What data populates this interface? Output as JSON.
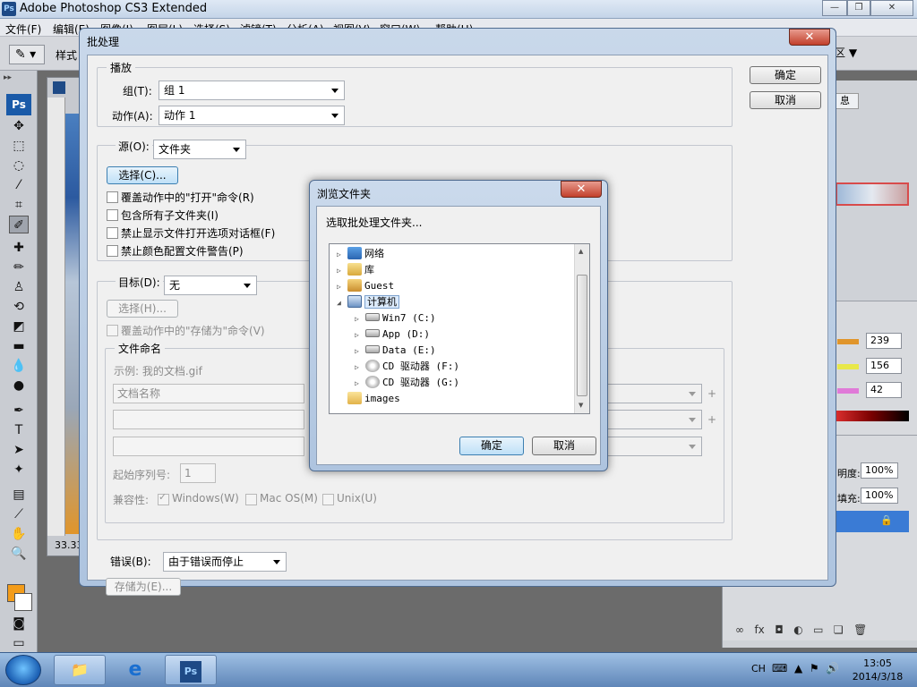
{
  "app": {
    "title": "Adobe Photoshop CS3 Extended",
    "logo": "Ps",
    "menus": [
      "文件(F)",
      "编辑(E)",
      "图像(I)",
      "图层(L)",
      "选择(S)",
      "滤镜(T)",
      "分析(A)",
      "视图(V)",
      "窗口(W)",
      "帮助(H)"
    ],
    "options_style_label": "样式",
    "zoom": "33.33"
  },
  "right_panels": {
    "tab_fragment": "息",
    "color_values": [
      "239",
      "156",
      "42"
    ],
    "opacity_label": "明度:",
    "opacity_value": "100%",
    "fill_label": "填充:",
    "fill_value": "100%"
  },
  "batch": {
    "title": "批处理",
    "ok": "确定",
    "cancel": "取消",
    "play": {
      "legend": "播放",
      "set_label": "组(T):",
      "set_value": "组 1",
      "action_label": "动作(A):",
      "action_value": "动作 1"
    },
    "source": {
      "label": "源(O):",
      "value": "文件夹",
      "choose": "选择(C)...",
      "options": [
        "覆盖动作中的\"打开\"命令(R)",
        "包含所有子文件夹(I)",
        "禁止显示文件打开选项对话框(F)",
        "禁止颜色配置文件警告(P)"
      ]
    },
    "destination": {
      "label": "目标(D):",
      "value": "无",
      "choose": "选择(H)...",
      "override_save": "覆盖动作中的\"存储为\"命令(V)",
      "naming": {
        "legend": "文件命名",
        "example": "示例: 我的文档.gif",
        "field1": "文档名称",
        "start_serial_label": "起始序列号:",
        "start_serial_value": "1",
        "compat_label": "兼容性:",
        "windows": "Windows(W)",
        "mac": "Mac OS(M)",
        "unix": "Unix(U)"
      }
    },
    "errors": {
      "label": "错误(B):",
      "value": "由于错误而停止",
      "save_as": "存储为(E)..."
    }
  },
  "browse": {
    "title": "浏览文件夹",
    "prompt": "选取批处理文件夹...",
    "tree": [
      {
        "label": "网络",
        "icon": "network-icon"
      },
      {
        "label": "库",
        "icon": "library-icon"
      },
      {
        "label": "Guest",
        "icon": "user-folder-icon"
      },
      {
        "label": "计算机",
        "icon": "computer-icon"
      },
      {
        "label": "Win7 (C:)",
        "icon": "drive-icon"
      },
      {
        "label": "App (D:)",
        "icon": "drive-icon"
      },
      {
        "label": "Data (E:)",
        "icon": "drive-icon"
      },
      {
        "label": "CD 驱动器 (F:)",
        "icon": "cd-drive-icon"
      },
      {
        "label": "CD 驱动器 (G:)",
        "icon": "cd-drive-icon"
      },
      {
        "label": "images",
        "icon": "folder-icon"
      }
    ],
    "ok": "确定",
    "cancel": "取消"
  },
  "taskbar": {
    "lang": "CH",
    "time": "13:05",
    "date": "2014/3/18"
  }
}
